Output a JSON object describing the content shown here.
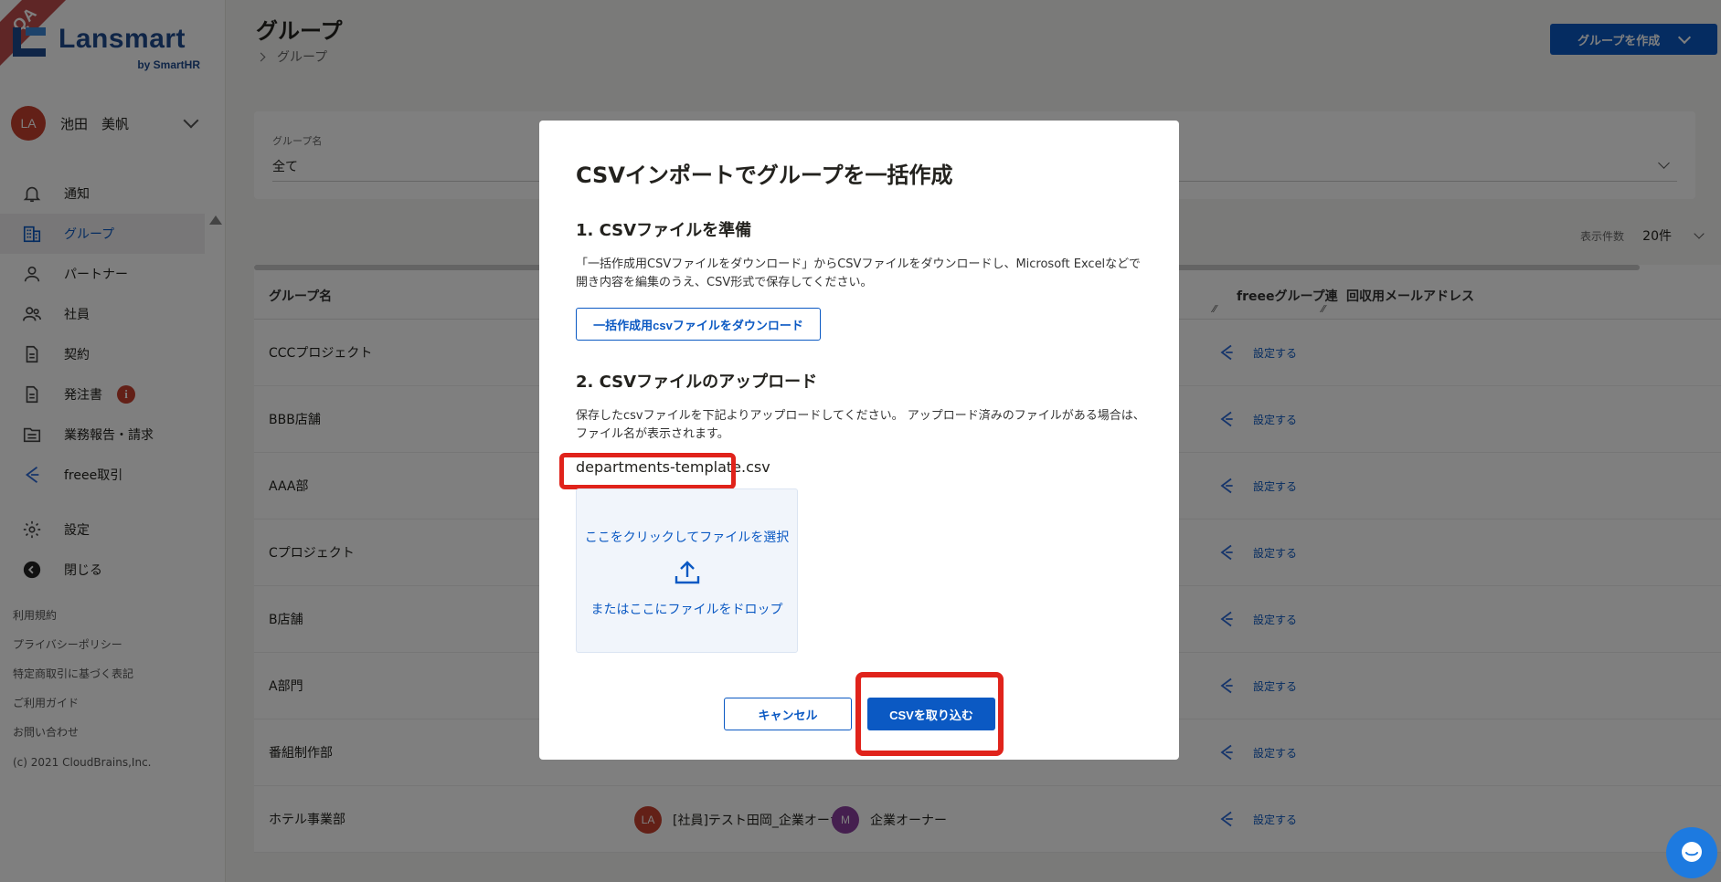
{
  "ribbon": "QA",
  "brand": {
    "name": "Lansmart",
    "sub": "by SmartHR"
  },
  "user": {
    "initials": "LA",
    "name": "池田　美帆"
  },
  "nav": [
    {
      "label": "通知",
      "icon": "bell-icon"
    },
    {
      "label": "グループ",
      "icon": "building-icon"
    },
    {
      "label": "パートナー",
      "icon": "person-icon"
    },
    {
      "label": "社員",
      "icon": "people-icon"
    },
    {
      "label": "契約",
      "icon": "document-icon"
    },
    {
      "label": "発注書",
      "icon": "document-icon",
      "badge": "i"
    },
    {
      "label": "業務報告・請求",
      "icon": "folder-icon"
    },
    {
      "label": "freee取引",
      "icon": "freee-icon"
    },
    {
      "label": "設定",
      "icon": "gear-icon"
    },
    {
      "label": "閉じる",
      "icon": "collapse-icon"
    }
  ],
  "footer_links": [
    "利用規約",
    "プライバシーポリシー",
    "特定商取引に基づく表記",
    "ご利用ガイド",
    "お問い合わせ"
  ],
  "copyright": "(c) 2021 CloudBrains,Inc.",
  "page": {
    "title": "グループ",
    "breadcrumb": "グループ",
    "create_button": "グループを作成",
    "filter_label": "グループ名",
    "filter_value": "全て",
    "per_page_label": "表示件数",
    "per_page_value": "20件"
  },
  "table": {
    "headers": {
      "name": "グループ名",
      "freee": "freeeグループ連",
      "email": "回収用メールアドレス"
    },
    "set_label": "設定する",
    "rows": [
      "CCCプロジェクト",
      "BBB店舗",
      "AAA部",
      "Cプロジェクト",
      "B店舗",
      "A部門",
      "番組制作部",
      "ホテル事業部"
    ],
    "hotel_members": [
      {
        "initials": "LA",
        "name": "[社員]テスト田岡_企業オーナー",
        "color": "#c6402f"
      },
      {
        "initials": "M",
        "name": "企業オーナー",
        "color": "#8a3f9e"
      }
    ]
  },
  "modal": {
    "title": "CSVインポートでグループを一括作成",
    "step1_title": "1. CSVファイルを準備",
    "step1_desc": "「一括作成用CSVファイルをダウンロード」からCSVファイルをダウンロードし、Microsoft Excelなどで開き内容を編集のうえ、CSV形式で保存してください。",
    "download_button": "一括作成用csvファイルをダウンロード",
    "step2_title": "2. CSVファイルのアップロード",
    "step2_desc": "保存したcsvファイルを下記よりアップロードしてください。 アップロード済みのファイルがある場合は、ファイル名が表示されます。",
    "file_name": "departments-template.csv",
    "drop_click": "ここをクリックしてファイルを選択",
    "drop_drag": "またはここにファイルをドロップ",
    "cancel_button": "キャンセル",
    "import_button": "CSVを取り込む"
  },
  "colors": {
    "primary": "#0b59c3",
    "highlight": "#e0231b",
    "danger": "#c6402f"
  }
}
